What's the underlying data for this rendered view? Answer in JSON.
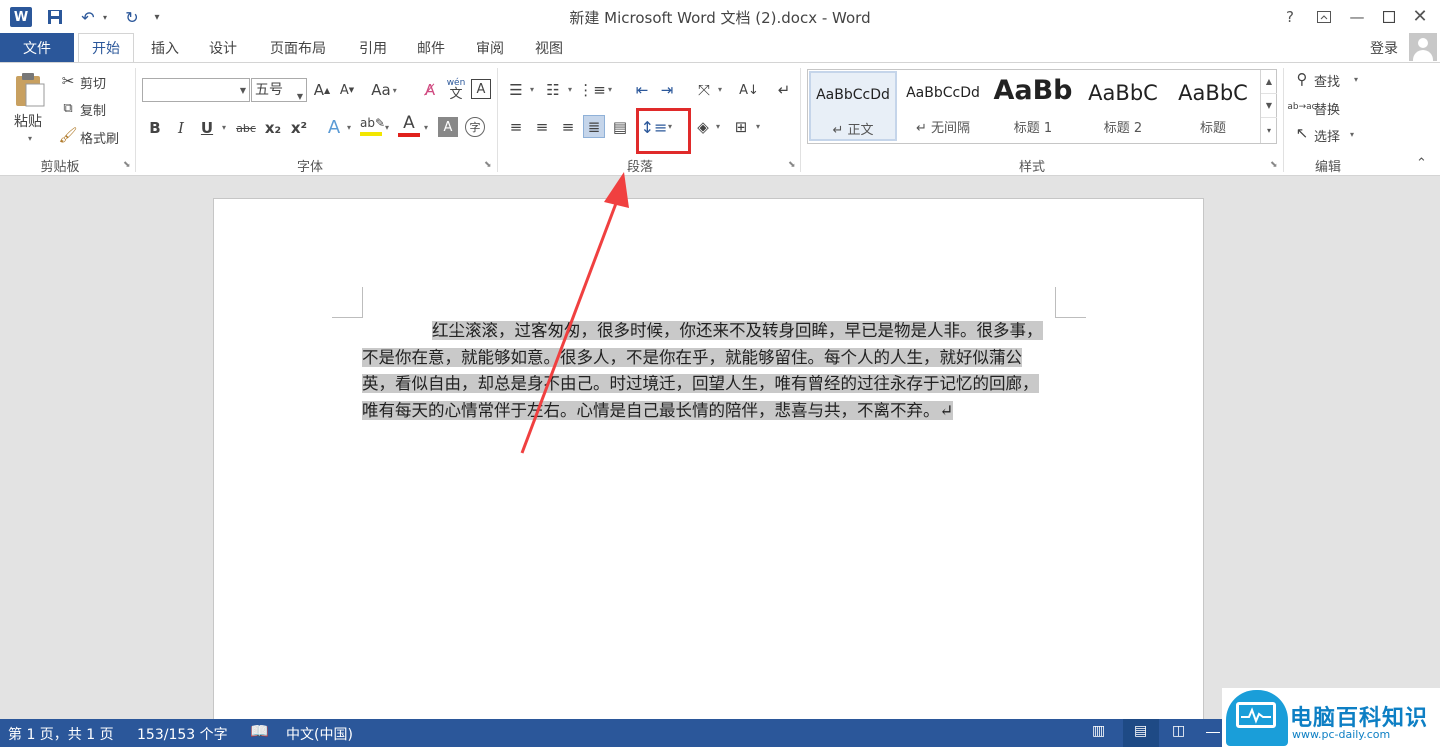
{
  "titlebar": {
    "app_icon": "W",
    "title": "新建 Microsoft Word 文档 (2).docx - Word",
    "qat_icons": [
      "save-icon",
      "undo-icon",
      "redo-icon",
      "customize-icon"
    ],
    "window_buttons": [
      "?",
      "restore-ribbon-icon",
      "minimize-icon",
      "maximize-icon",
      "close-icon"
    ]
  },
  "tabs": {
    "file": "文件",
    "items": [
      "开始",
      "插入",
      "设计",
      "页面布局",
      "引用",
      "邮件",
      "审阅",
      "视图"
    ],
    "active": "开始",
    "login": "登录"
  },
  "ribbon": {
    "clipboard": {
      "label": "剪贴板",
      "paste": "粘贴",
      "cut": "剪切",
      "copy": "复制",
      "format_painter": "格式刷"
    },
    "font": {
      "label": "字体",
      "font_name": "",
      "font_size": "五号",
      "aa": "Aa",
      "wen": "wén",
      "wen_char": "文",
      "format_buttons": [
        "B",
        "I",
        "U",
        "abc",
        "x₂",
        "x²"
      ],
      "font_color": "#e0211c",
      "highlight_color": "#f2e600"
    },
    "paragraph": {
      "label": "段落"
    },
    "styles": {
      "label": "样式",
      "items": [
        {
          "sample": "AaBbCcDd",
          "name": "↵ 正文"
        },
        {
          "sample": "AaBbCcDd",
          "name": "↵ 无间隔"
        },
        {
          "sample": "AaBb",
          "name": "标题 1"
        },
        {
          "sample": "AaBbC",
          "name": "标题 2"
        },
        {
          "sample": "AaBbC",
          "name": "标题"
        }
      ]
    },
    "editing": {
      "label": "编辑",
      "find": "查找",
      "replace": "替换",
      "select": "选择"
    }
  },
  "document": {
    "paragraph_lines": [
      "红尘滚滚，过客匆匆，很多时候，你还来不及转身回眸，早已是物是人非。很多事，",
      "不是你在意，就能够如意。很多人，不是你在乎，就能够留住。每个人的人生，就好似蒲公",
      "英，看似自由，却总是身不由己。时过境迁，回望人生，唯有曾经的过往永存于记忆的回廊，",
      "唯有每天的心情常伴于左右。心情是自己最长情的陪伴，悲喜与共，不离不弃。↵"
    ],
    "selection_color": "#c9c9c9"
  },
  "annotation": {
    "box_color": "#e02a2a",
    "arrow_color": "#f04040"
  },
  "statusbar": {
    "page": "第 1 页，共 1 页",
    "words": "153/153 个字",
    "language": "中文(中国)"
  },
  "watermark": {
    "text": "电脑百科知识",
    "url": "www.pc-daily.com"
  }
}
